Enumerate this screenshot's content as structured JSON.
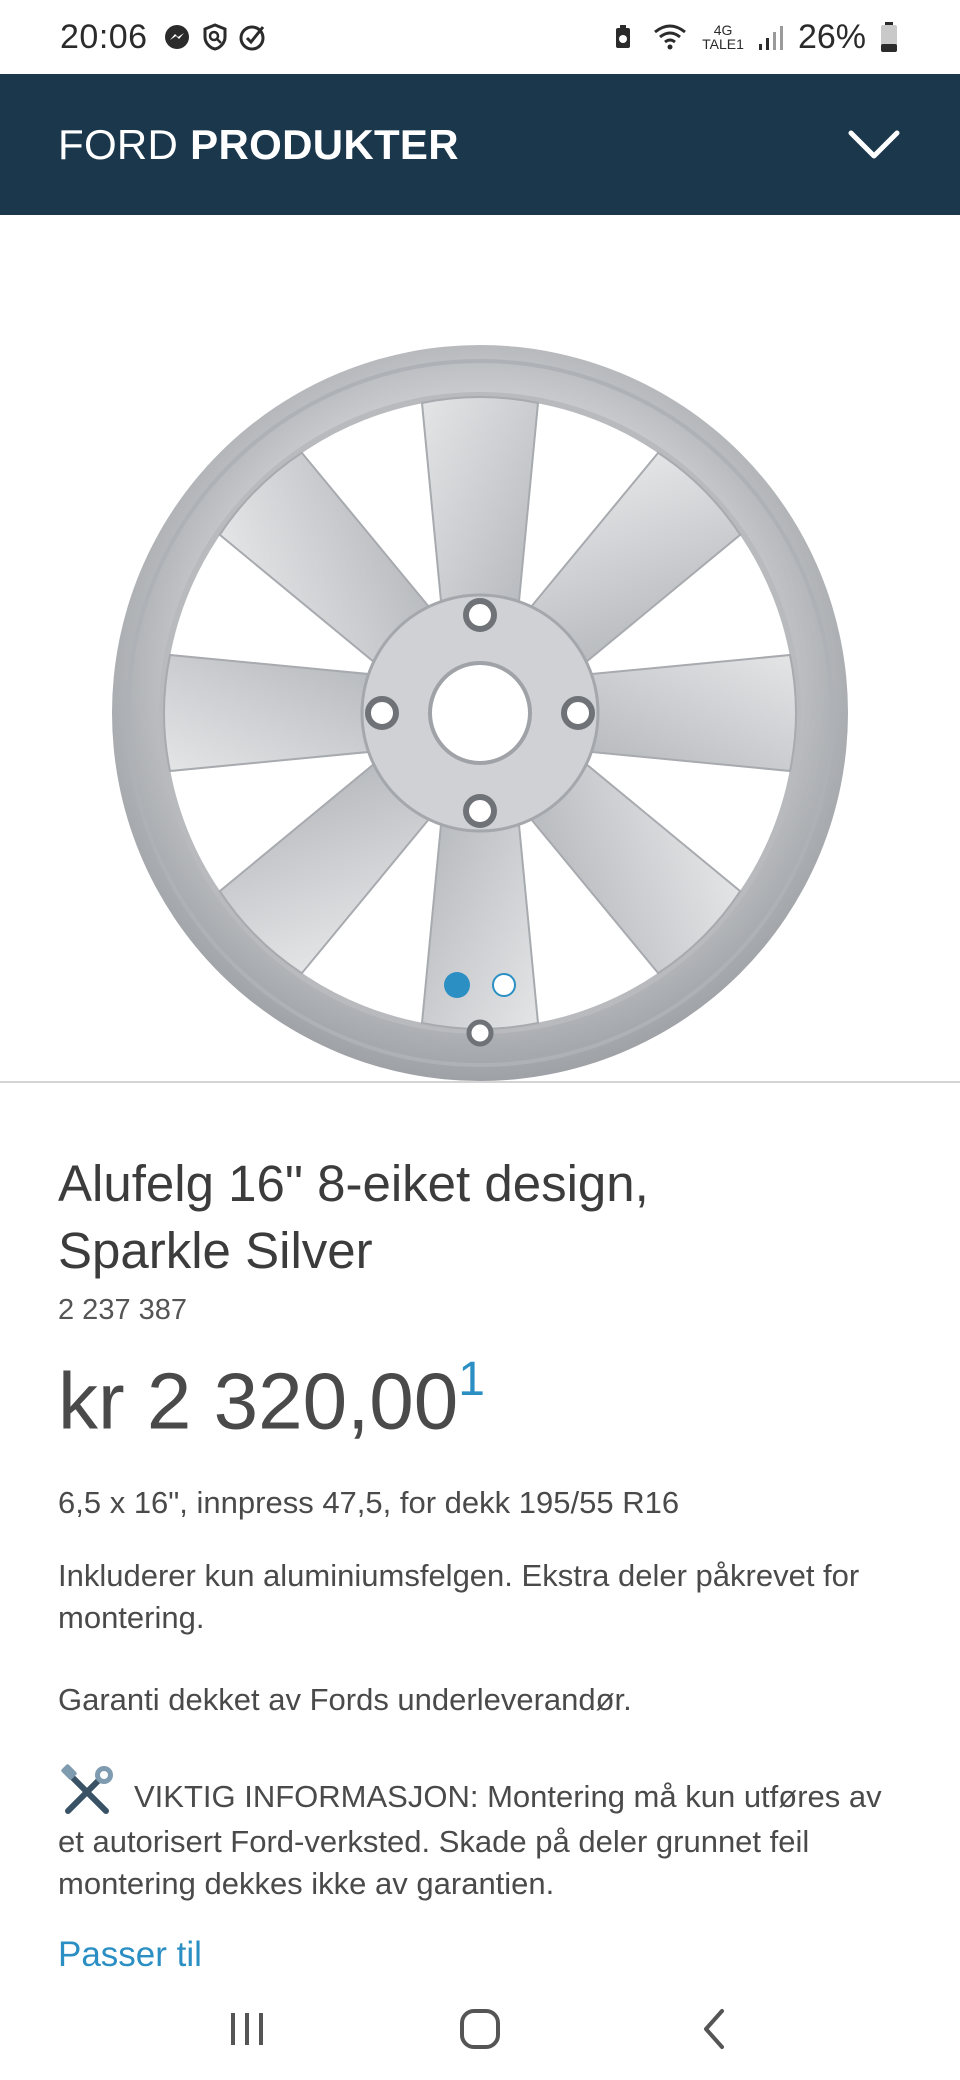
{
  "status_bar": {
    "time": "20:06",
    "network": "4G",
    "carrier": "TALE1",
    "battery": "26%"
  },
  "header": {
    "brand_light": "FORD",
    "brand_bold": "PRODUKTER",
    "menu_icon": "chevron-down-icon"
  },
  "carousel": {
    "image_alt": "Alufelg 16\" 8-eiket design, Sparkle Silver",
    "active_index": 0,
    "count": 2
  },
  "product": {
    "title_line1": "Alufelg 16\" 8-eiket design,",
    "title_line2": "Sparkle Silver",
    "part_number": "2 237 387",
    "price": "kr 2 320,00",
    "price_footnote": "1",
    "spec": "6,5 x 16\", innpress 47,5, for dekk 195/55 R16",
    "description": "Inkluderer kun aluminiumsfelgen. Ekstra deler påkrevet for montering.",
    "warranty": "Garanti dekket av Fords underleverandør.",
    "important_info": "VIKTIG INFORMASJON: Montering må kun utføres av et autorisert Ford-verksted. Skade på deler grunnet feil montering dekkes ikke av garantien.",
    "fits_link": "Passer til"
  },
  "colors": {
    "header_bg": "#1b374c",
    "accent": "#2b8fc3",
    "text": "#4a4a4a"
  },
  "nav": {
    "recent": "recent-apps-icon",
    "home": "home-icon",
    "back": "back-icon"
  }
}
